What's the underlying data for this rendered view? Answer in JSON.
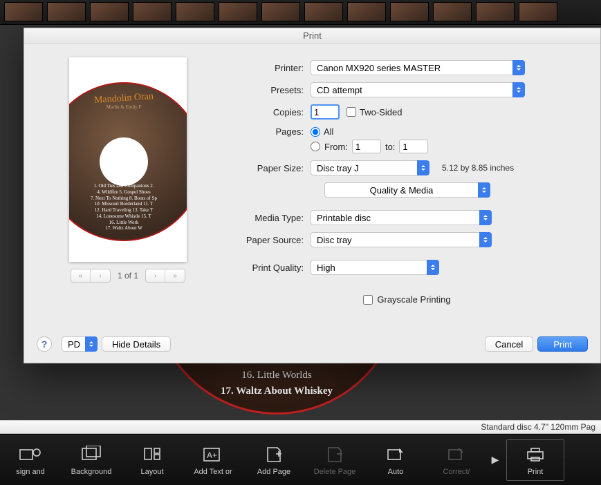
{
  "dialog": {
    "title": "Print",
    "pager_label": "1 of 1",
    "labels": {
      "printer": "Printer:",
      "presets": "Presets:",
      "copies": "Copies:",
      "two_sided": "Two-Sided",
      "pages": "Pages:",
      "all": "All",
      "from": "From:",
      "to": "to:",
      "paper_size": "Paper Size:",
      "paper_size_note": "5.12 by 8.85 inches",
      "section": "Quality & Media",
      "media_type": "Media Type:",
      "paper_source": "Paper Source:",
      "print_quality": "Print Quality:",
      "grayscale": "Grayscale Printing"
    },
    "values": {
      "printer": "Canon MX920 series MASTER",
      "presets": "CD attempt",
      "copies": "1",
      "two_sided_checked": false,
      "pages_mode": "all",
      "from": "1",
      "to": "1",
      "paper_size": "Disc tray J",
      "media_type": "Printable disc",
      "paper_source": "Disc tray",
      "print_quality": "High",
      "grayscale_checked": false
    },
    "footer": {
      "help": "?",
      "pdf": "PDF",
      "hide_details": "Hide Details",
      "cancel": "Cancel",
      "print": "Print"
    },
    "preview": {
      "album_title": "Mandolin Oran",
      "album_sub": "Marlin & Emily F",
      "tracks": [
        "1. Old Ties and Companions   2.",
        "4. Wildfire   5. Gospel Shoes",
        "7. Next To Nothing   8. Boots of Sp",
        "10. Missouri Borderland   11. T",
        "12. Hard Traveling   13. Take T",
        "14. Lonesome Whistle 15. T",
        "16. Little Work",
        "17. Waltz About W"
      ]
    }
  },
  "background": {
    "peek_tracks": {
      "t16": "16. Little Worlds",
      "t17": "17. Waltz About Whiskey"
    },
    "status_text": "Standard disc 4.7\" 120mm Pag",
    "tools": {
      "design": "sign and",
      "background": "Background",
      "layout": "Layout",
      "addtext": "Add Text or",
      "addpage": "Add Page",
      "deletepage": "Delete Page",
      "auto": "Auto",
      "correct": "Correct/",
      "print": "Print"
    }
  }
}
